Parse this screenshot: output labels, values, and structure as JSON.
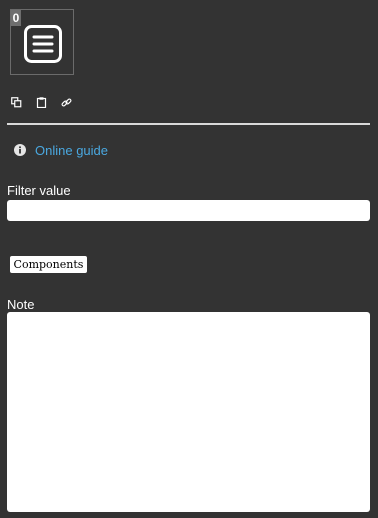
{
  "preview": {
    "index": "0",
    "icon": "hamburger-menu-icon"
  },
  "toolbar": {
    "icons": [
      "copy-icon",
      "paste-icon",
      "link-icon"
    ]
  },
  "guide": {
    "icon": "info-icon",
    "label": "Online guide",
    "color": "#4aa8e0"
  },
  "filter": {
    "label": "Filter value",
    "value": "",
    "placeholder": ""
  },
  "components_button": {
    "label": "Components"
  },
  "note": {
    "label": "Note",
    "value": "",
    "placeholder": ""
  },
  "colors": {
    "background": "#333333",
    "divider": "#d9d9d9",
    "link": "#4aa8e0"
  }
}
